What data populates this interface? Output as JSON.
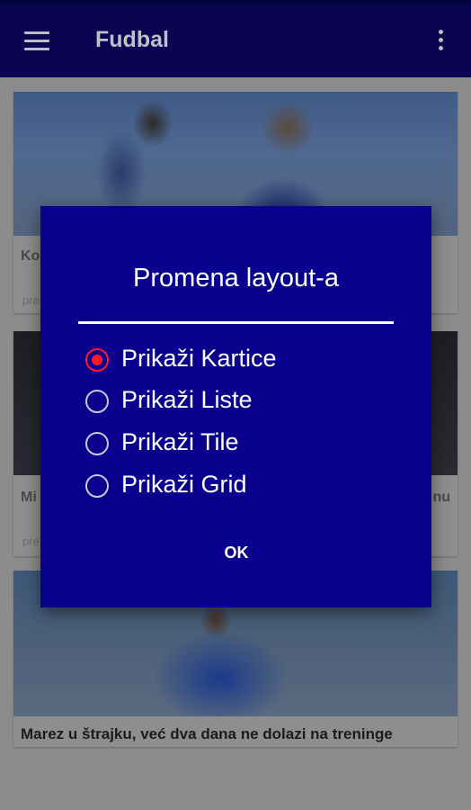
{
  "appbar": {
    "title": "Fudbal",
    "menu_icon": "hamburger-menu-icon",
    "overflow_icon": "more-vert-icon",
    "background": "#0c0452"
  },
  "feed": {
    "cards": [
      {
        "caption": "Ko",
        "meta": "pre"
      },
      {
        "caption": "Mi",
        "caption_right": "nu",
        "meta": "pre"
      },
      {
        "caption": "Marez u štrajku, već dva dana ne dolazi na treninge"
      }
    ]
  },
  "dialog": {
    "title": "Promena layout-a",
    "background": "#09008d",
    "accent": "#ff1a2a",
    "options": [
      {
        "label": "Prikaži Kartice",
        "selected": true
      },
      {
        "label": "Prikaži Liste",
        "selected": false
      },
      {
        "label": "Prikaži Tile",
        "selected": false
      },
      {
        "label": "Prikaži Grid",
        "selected": false
      }
    ],
    "ok_label": "OK"
  }
}
